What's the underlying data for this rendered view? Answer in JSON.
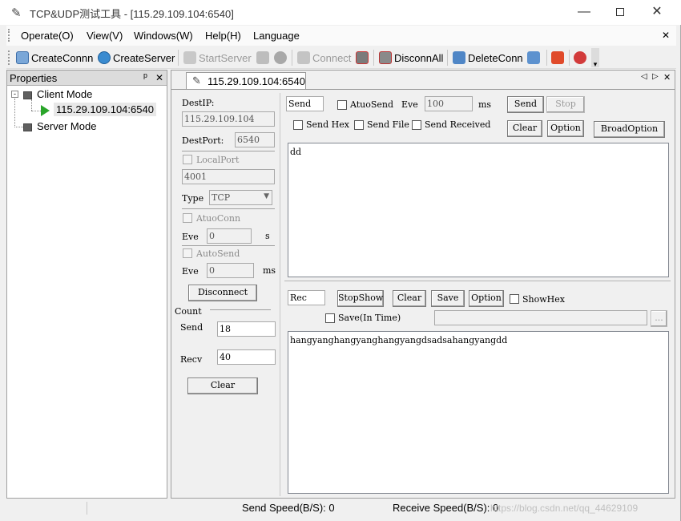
{
  "window": {
    "title": "TCP&UDP测试工具 - [115.29.109.104:6540]"
  },
  "menu": {
    "items": [
      "Operate(O)",
      "View(V)",
      "Windows(W)",
      "Help(H)",
      "Language"
    ],
    "close_glyph": "✕"
  },
  "toolbar": {
    "create_conn": "CreateConnn",
    "create_server": "CreateServer",
    "start_server": "StartServer",
    "connect": "Connect",
    "disconn_all": "DisconnAll",
    "delete_conn": "DeleteConn"
  },
  "properties": {
    "title": "Properties",
    "pin": "ᵖ",
    "close": "✕",
    "client_mode": "Client Mode",
    "connection": "115.29.109.104:6540",
    "server_mode": "Server Mode"
  },
  "tab": {
    "label": "115.29.109.104:6540",
    "nav_left": "◁",
    "nav_right": "▷",
    "close": "✕"
  },
  "conn_panel": {
    "dest_ip_label": "DestIP:",
    "dest_ip": "115.29.109.104",
    "dest_port_label": "DestPort:",
    "dest_port": "6540",
    "local_port_label": "LocalPort",
    "local_port": "4001",
    "type_label": "Type",
    "type_value": "TCP",
    "auto_conn_label": "AtuoConn",
    "eve_label": "Eve",
    "auto_conn_eve": "0",
    "s_unit": "s",
    "auto_send_label": "AutoSend",
    "auto_send_eve": "0",
    "ms_unit": "ms",
    "disconnect": "Disconnect",
    "count_label": "Count",
    "send_label": "Send",
    "send_count": "18",
    "recv_label": "Recv",
    "recv_count": "40",
    "clear": "Clear"
  },
  "send_panel": {
    "mode": "Send",
    "atuo_send": "AtuoSend",
    "eve": "Eve",
    "eve_value": "100",
    "ms": "ms",
    "send_btn": "Send",
    "stop_btn": "Stop",
    "send_hex": "Send Hex",
    "send_file": "Send File",
    "send_received": "Send Received",
    "clear": "Clear",
    "option": "Option",
    "broad_option": "BroadOption",
    "content": "dd"
  },
  "rec_panel": {
    "mode": "Rec",
    "stop_show": "StopShow",
    "clear": "Clear",
    "save": "Save",
    "option": "Option",
    "show_hex": "ShowHex",
    "save_in_time": "Save(In Time)",
    "browse": "...",
    "content": "hangyanghangyanghangyangdsadsahangyangdd"
  },
  "status": {
    "send_speed": "Send Speed(B/S): 0",
    "receive_speed": "Receive Speed(B/S): 0",
    "watermark": "https://blog.csdn.net/qq_44629109"
  }
}
